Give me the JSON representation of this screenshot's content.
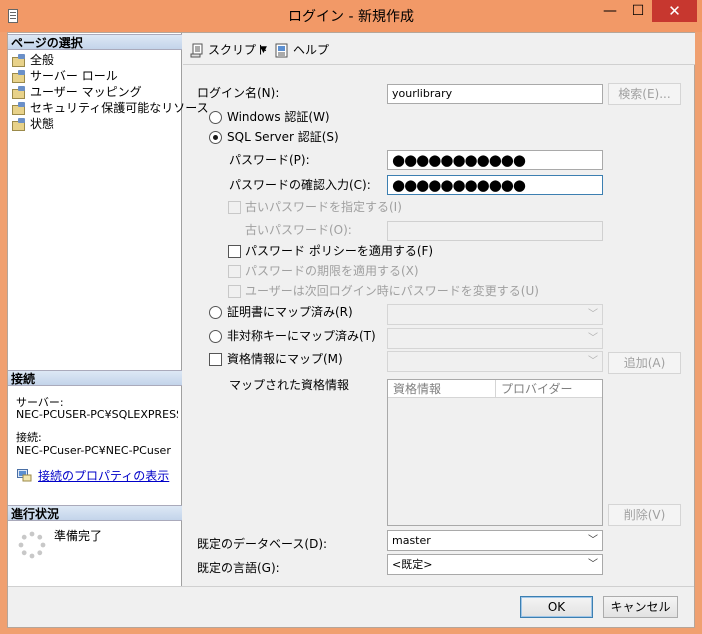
{
  "window": {
    "title": "ログイン - 新規作成",
    "minimize": "—",
    "maximize": "☐",
    "close": "✕"
  },
  "sidebar": {
    "pages_header": "ページの選択",
    "items": [
      {
        "label": "全般"
      },
      {
        "label": "サーバー ロール"
      },
      {
        "label": "ユーザー マッピング"
      },
      {
        "label": "セキュリティ保護可能なリソース"
      },
      {
        "label": "状態"
      }
    ],
    "connection_header": "接続",
    "server_label": "サーバー:",
    "server_value": "NEC-PCUSER-PC¥SQLEXPRESS",
    "connection_label": "接続:",
    "connection_value": "NEC-PCuser-PC¥NEC-PCuser",
    "connection_link": "接続のプロパティの表示",
    "progress_header": "進行状況",
    "progress_status": "準備完了"
  },
  "toolbar": {
    "script_label": "スクリプト",
    "dropdown_arrow": "▼",
    "help_label": "ヘルプ"
  },
  "form": {
    "login_name_label": "ログイン名(N):",
    "login_name_value": "yourlibrary",
    "search_button": "検索(E)...",
    "windows_auth_label": "Windows 認証(W)",
    "sql_auth_label": "SQL Server 認証(S)",
    "password_label": "パスワード(P):",
    "password_value": "●●●●●●●●●●●",
    "confirm_password_label": "パスワードの確認入力(C):",
    "confirm_password_value": "●●●●●●●●●●●",
    "old_password_check_label": "古いパスワードを指定する(I)",
    "old_password_label": "古いパスワード(O):",
    "enforce_policy_label": "パスワード ポリシーを適用する(F)",
    "enforce_expiration_label": "パスワードの期限を適用する(X)",
    "must_change_label": "ユーザーは次回ログイン時にパスワードを変更する(U)",
    "cert_mapped_label": "証明書にマップ済み(R)",
    "asym_key_mapped_label": "非対称キーにマップ済み(T)",
    "credential_mapped_label": "資格情報にマップ(M)",
    "add_button": "追加(A)",
    "mapped_credentials_label": "マップされた資格情報",
    "grid_columns": [
      "資格情報",
      "プロバイダー"
    ],
    "remove_button": "削除(V)",
    "default_db_label": "既定のデータベース(D):",
    "default_db_value": "master",
    "default_lang_label": "既定の言語(G):",
    "default_lang_value": "<既定>"
  },
  "footer": {
    "ok_button": "OK",
    "cancel_button": "キャンセル"
  },
  "state": {
    "auth_mode": "sql",
    "enforce_policy": false,
    "credential_mapped": false
  }
}
